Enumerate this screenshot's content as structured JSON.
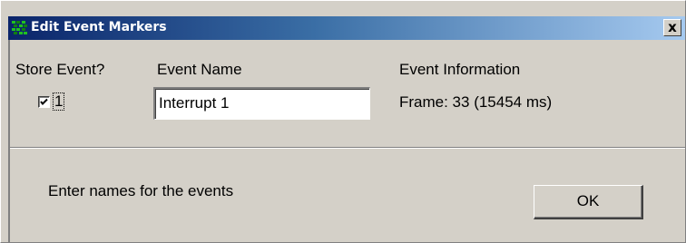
{
  "window": {
    "title": "Edit Event Markers",
    "close_glyph": "x",
    "icon": "app-grid-icon"
  },
  "headers": {
    "store_event": "Store Event?",
    "event_name": "Event Name",
    "event_information": "Event Information"
  },
  "events": [
    {
      "checked": true,
      "index_label": "1",
      "name_value": "Interrupt 1",
      "information": "Frame: 33 (15454 ms)"
    }
  ],
  "footer": {
    "instruction": "Enter names for the events",
    "ok_label": "OK"
  },
  "colors": {
    "titlebar_start": "#0a246a",
    "titlebar_end": "#a6caf0",
    "face": "#d4d0c8"
  }
}
